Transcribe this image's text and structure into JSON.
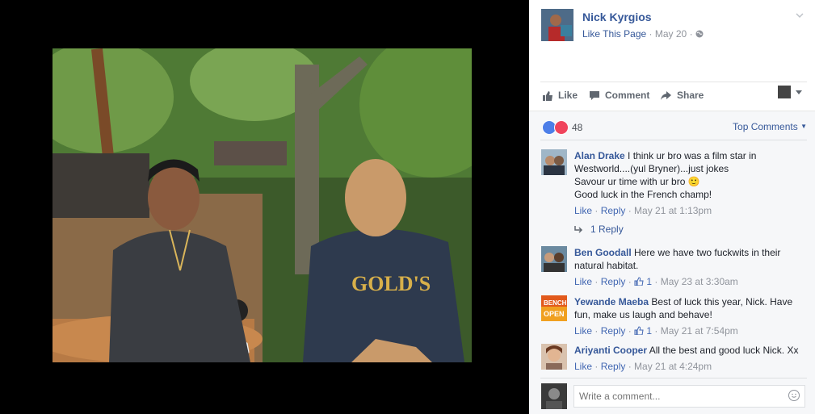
{
  "post": {
    "page_name": "Nick Kyrgios",
    "like_page": "Like This Page",
    "date": "May 20",
    "actions": {
      "like": "Like",
      "comment": "Comment",
      "share": "Share"
    },
    "reactions_count": "48",
    "sort_label": "Top Comments"
  },
  "comments": [
    {
      "author": "Alan Drake",
      "text_lines": [
        "I think ur bro was a film star in",
        "Westworld....(yul Bryner)...just jokes",
        "Savour ur time with ur bro 🙂",
        "Good luck in the French champ!"
      ],
      "like": "Like",
      "reply": "Reply",
      "likes": "",
      "time": "May 21 at 1:13pm",
      "replies": "1 Reply"
    },
    {
      "author": "Ben Goodall",
      "text_lines": [
        "Here we have two fuckwits in their",
        "natural habitat."
      ],
      "like": "Like",
      "reply": "Reply",
      "likes": "1",
      "time": "May 23 at 3:30am"
    },
    {
      "author": "Yewande Maeba",
      "text_lines": [
        "Best of luck this year, Nick. Have",
        "fun, make us laugh and behave!"
      ],
      "like": "Like",
      "reply": "Reply",
      "likes": "1",
      "time": "May 21 at 7:54pm"
    },
    {
      "author": "Ariyanti Cooper",
      "text_lines": [
        "All the best and good luck Nick. Xx"
      ],
      "like": "Like",
      "reply": "Reply",
      "likes": "",
      "time": "May 21 at 4:24pm"
    }
  ],
  "write_comment": {
    "placeholder": "Write a comment..."
  },
  "colors": {
    "link": "#365899",
    "meta": "#90949c",
    "panel_bg": "#f6f7f9"
  },
  "icons": [
    "chevron-down-icon",
    "globe-icon",
    "like-icon",
    "comment-icon",
    "share-icon",
    "reply-arrow-icon",
    "thumbs-up-icon",
    "smiley-icon"
  ]
}
